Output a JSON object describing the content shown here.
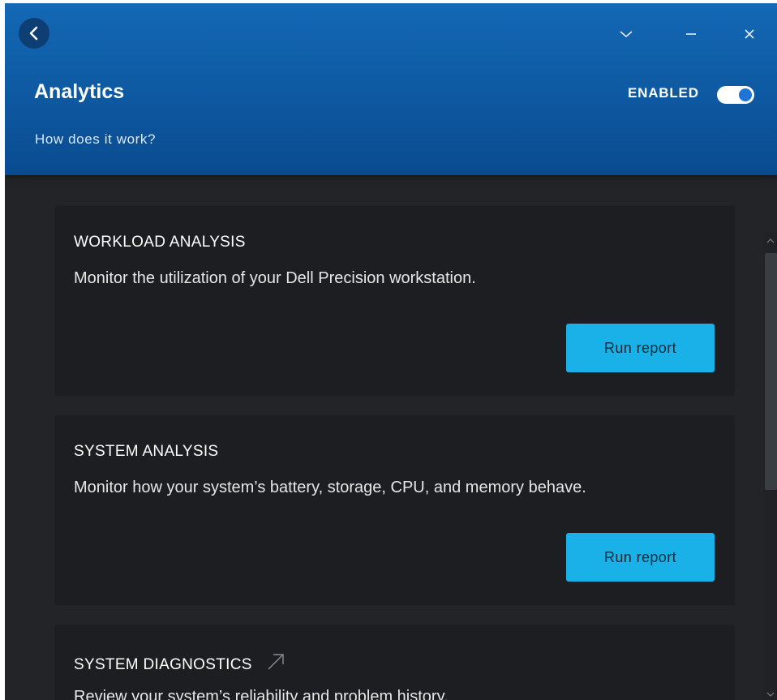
{
  "header": {
    "title": "Analytics",
    "how_link": "How does it work?",
    "enabled_label": "ENABLED",
    "toggle_on": true,
    "accent_color": "#1f74d6"
  },
  "window_controls": {
    "icons": [
      "back-arrow-icon",
      "chevron-down-icon",
      "minimize-icon",
      "close-icon"
    ]
  },
  "cards": [
    {
      "title": "WORKLOAD ANALYSIS",
      "description": "Monitor the utilization of your Dell Precision workstation.",
      "button_label": "Run report"
    },
    {
      "title": "SYSTEM ANALYSIS",
      "description": "Monitor how your system’s battery, storage, CPU, and memory behave.",
      "button_label": "Run report"
    },
    {
      "title": "SYSTEM DIAGNOSTICS",
      "description": "Review your system’s reliability and problem history.",
      "external_link_icon": "external-link-icon"
    }
  ],
  "colors": {
    "header_blue": "#0e5aa3",
    "background": "#222428",
    "card": "#1c1e22",
    "button": "#1ab0e8"
  }
}
